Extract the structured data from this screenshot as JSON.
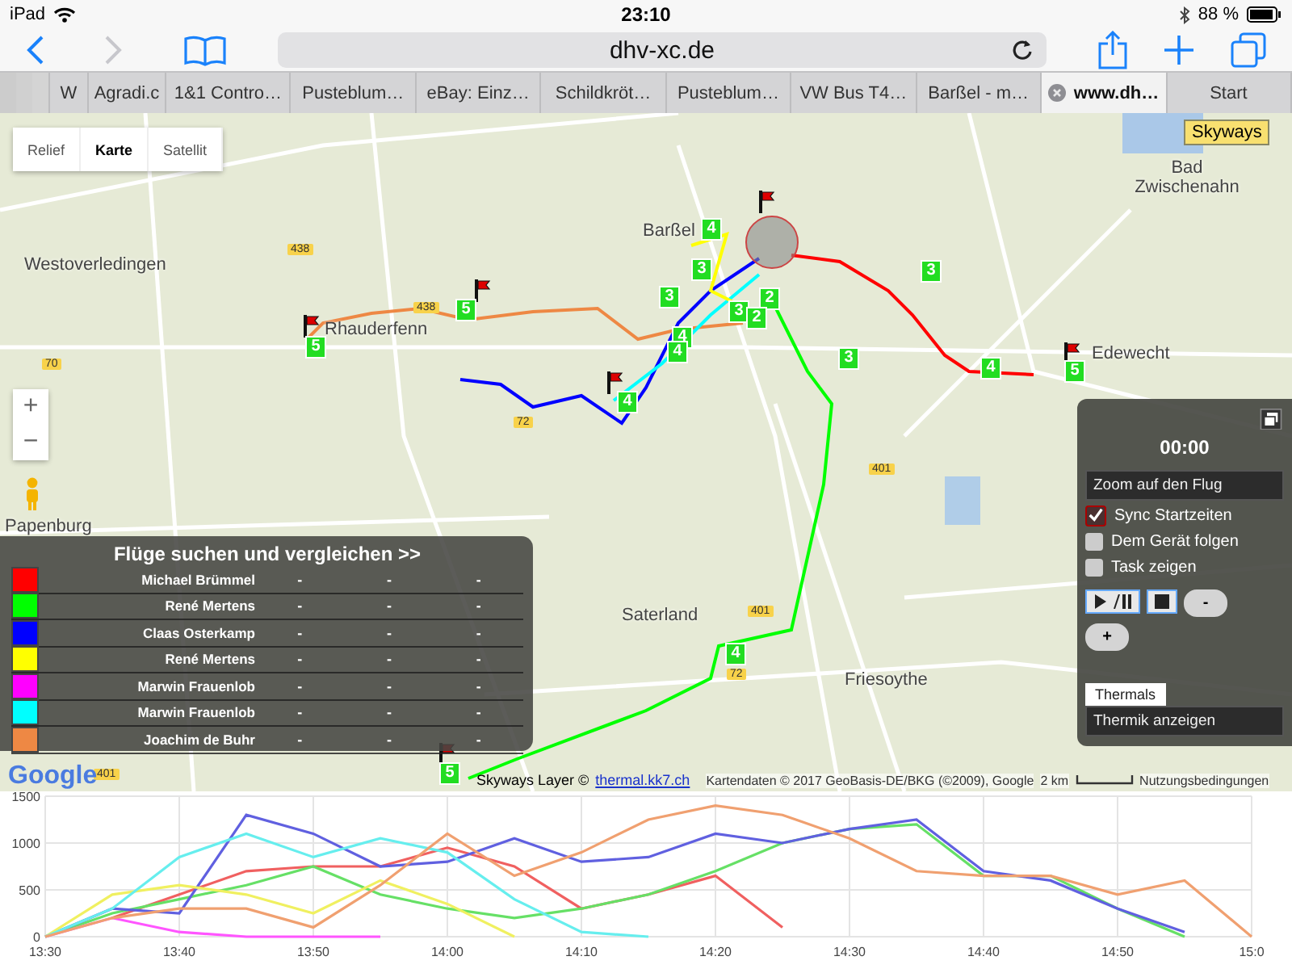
{
  "status_bar": {
    "device": "iPad",
    "time": "23:10",
    "battery": "88 %"
  },
  "toolbar": {
    "url": "dhv-xc.de",
    "back_enabled": true,
    "forward_enabled": false
  },
  "tabs": [
    {
      "label": "W",
      "selected": false
    },
    {
      "label": "Agradi.c",
      "selected": false
    },
    {
      "label": "1&1 Contro…",
      "selected": false
    },
    {
      "label": "Pusteblum…",
      "selected": false
    },
    {
      "label": "eBay: Einz…",
      "selected": false
    },
    {
      "label": "Schildkröt…",
      "selected": false
    },
    {
      "label": "Pusteblum…",
      "selected": false
    },
    {
      "label": "VW Bus T4…",
      "selected": false
    },
    {
      "label": "Barßel - m…",
      "selected": false
    },
    {
      "label": "www.dh…",
      "selected": true
    },
    {
      "label": "Start",
      "selected": false
    }
  ],
  "map": {
    "map_types": [
      {
        "label": "Relief",
        "selected": false
      },
      {
        "label": "Karte",
        "selected": true
      },
      {
        "label": "Satellit",
        "selected": false
      }
    ],
    "zoom_in": "+",
    "zoom_out": "−",
    "places": [
      "Bad Zwischenahn",
      "Westoverledingen",
      "Barßel",
      "Rhauderfenn",
      "Edewecht",
      "Papenburg",
      "Saterland",
      "Friesoythe"
    ],
    "roads": [
      "438",
      "438",
      "70",
      "72",
      "401",
      "401",
      "72",
      "401"
    ],
    "markers": [
      "4",
      "3",
      "3",
      "3",
      "2",
      "2",
      "4",
      "4",
      "3",
      "3",
      "4",
      "5",
      "5",
      "5",
      "4",
      "4",
      "5"
    ],
    "skyways_tag": "Skyways",
    "logo": "Google",
    "attribution": {
      "layer": "Skyways Layer ©",
      "link": "thermal.kk7.ch",
      "data": "Kartendaten © 2017 GeoBasis-DE/BKG (©2009), Google",
      "scale": "2 km",
      "terms": "Nutzungsbedingungen"
    }
  },
  "flight_panel": {
    "title": "Flüge suchen und vergleichen >>",
    "pilots": [
      {
        "name": "Michael Brümmel",
        "color": "#ff0000",
        "col_2": "-",
        "col_3": "-",
        "col_4": "-"
      },
      {
        "name": "René Mertens",
        "color": "#00ff00",
        "col_2": "-",
        "col_3": "-",
        "col_4": "-"
      },
      {
        "name": "Claas Osterkamp",
        "color": "#0000ff",
        "col_2": "-",
        "col_3": "-",
        "col_4": "-"
      },
      {
        "name": "René Mertens",
        "color": "#ffff00",
        "col_2": "-",
        "col_3": "-",
        "col_4": "-"
      },
      {
        "name": "Marwin Frauenlob",
        "color": "#ff00ff",
        "col_2": "-",
        "col_3": "-",
        "col_4": "-"
      },
      {
        "name": "Marwin Frauenlob",
        "color": "#00ffff",
        "col_2": "-",
        "col_3": "-",
        "col_4": "-"
      },
      {
        "name": "Joachim de Buhr",
        "color": "#ee8844",
        "col_2": "-",
        "col_3": "-",
        "col_4": "-"
      }
    ]
  },
  "player_panel": {
    "time": "00:00",
    "view_select": "Zoom auf den Flug",
    "options": [
      {
        "label": "Sync Startzeiten",
        "checked": true
      },
      {
        "label": "Dem Gerät folgen",
        "checked": false
      },
      {
        "label": "Task zeigen",
        "checked": false
      }
    ],
    "slower": "-",
    "faster": "+",
    "tab": "Thermals",
    "thermal_select": "Thermik anzeigen"
  },
  "altitude_chart": {
    "chart_data": {
      "type": "line",
      "categories": [
        "13:30",
        null,
        "13:40",
        null,
        "13:50",
        null,
        "14:00",
        null,
        "14:10",
        null,
        "14:20",
        null,
        "14:30",
        null,
        "14:40",
        null,
        "14:50",
        null,
        "15:0"
      ],
      "yticks": [
        0,
        500,
        1000,
        1500
      ],
      "ylim": [
        0,
        1500
      ],
      "grid": true,
      "series": [
        {
          "color": "#f06060",
          "values": [
            null,
            200,
            450,
            700,
            750,
            750,
            950,
            750,
            300,
            450,
            650,
            100,
            null,
            null,
            null,
            null,
            null,
            null,
            null
          ]
        },
        {
          "color": "#66e066",
          "values": [
            0,
            250,
            400,
            550,
            750,
            450,
            300,
            200,
            300,
            450,
            700,
            1000,
            1150,
            1200,
            650,
            650,
            300,
            0,
            null
          ]
        },
        {
          "color": "#6060e0",
          "values": [
            0,
            300,
            250,
            1300,
            1100,
            750,
            800,
            1050,
            800,
            850,
            1100,
            1000,
            1150,
            1250,
            700,
            600,
            300,
            50,
            null
          ]
        },
        {
          "color": "#f0f060",
          "values": [
            0,
            450,
            550,
            450,
            250,
            600,
            350,
            0,
            null,
            null,
            null,
            null,
            null,
            null,
            null,
            null,
            null,
            null,
            null
          ]
        },
        {
          "color": "#ff55ff",
          "values": [
            0,
            200,
            50,
            0,
            0,
            0,
            null,
            null,
            null,
            null,
            null,
            null,
            null,
            null,
            null,
            null,
            null,
            null,
            null
          ]
        },
        {
          "color": "#66eeee",
          "values": [
            0,
            300,
            850,
            1100,
            850,
            1050,
            900,
            400,
            50,
            0,
            null,
            null,
            null,
            null,
            null,
            null,
            null,
            null,
            null
          ]
        },
        {
          "color": "#f0a070",
          "values": [
            0,
            200,
            300,
            300,
            100,
            550,
            1100,
            650,
            900,
            1250,
            1400,
            1300,
            1050,
            700,
            650,
            650,
            450,
            600,
            0
          ]
        }
      ]
    }
  }
}
